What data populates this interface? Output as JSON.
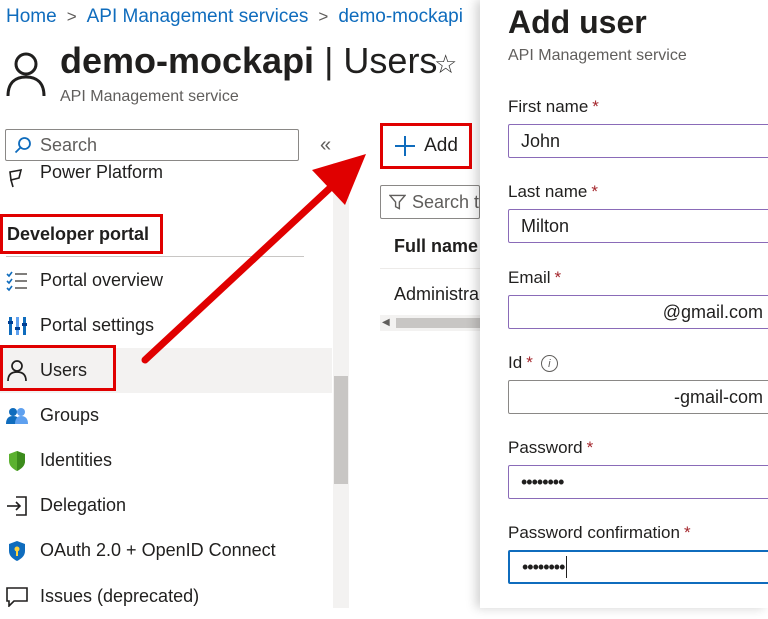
{
  "breadcrumb": {
    "items": [
      "Home",
      "API Management services",
      "demo-mockapi"
    ]
  },
  "header": {
    "title_bold": "demo-mockapi",
    "title_sep": " | ",
    "title_rest": "Users",
    "subtitle": "API Management service"
  },
  "sidebar": {
    "search_placeholder": "Search",
    "collapse_glyph": "«",
    "partial_item": "Power Platform",
    "section_title": "Developer portal",
    "items": [
      {
        "label": "Portal overview",
        "icon": "list-check-icon"
      },
      {
        "label": "Portal settings",
        "icon": "sliders-icon"
      },
      {
        "label": "Users",
        "icon": "user-icon",
        "selected": true
      },
      {
        "label": "Groups",
        "icon": "group-icon"
      },
      {
        "label": "Identities",
        "icon": "shield-icon"
      },
      {
        "label": "Delegation",
        "icon": "sign-in-icon"
      },
      {
        "label": "OAuth 2.0 + OpenID Connect",
        "icon": "shield-key-icon"
      },
      {
        "label": "Issues (deprecated)",
        "icon": "comment-icon"
      }
    ]
  },
  "toolbar": {
    "add_label": "Add"
  },
  "list": {
    "filter_placeholder": "Search t",
    "column_full_name": "Full name",
    "rows": [
      "Administra"
    ]
  },
  "panel": {
    "title": "Add user",
    "subtitle": "API Management service",
    "required_mark": "*",
    "fields": {
      "first_name": {
        "label": "First name",
        "value": "John"
      },
      "last_name": {
        "label": "Last name",
        "value": "Milton"
      },
      "email": {
        "label": "Email",
        "value": "@gmail.com"
      },
      "id": {
        "label": "Id",
        "value": "-gmail-com",
        "info": "i"
      },
      "password": {
        "label": "Password",
        "value": "••••••••"
      },
      "password_confirmation": {
        "label": "Password confirmation",
        "value": "••••••••"
      }
    }
  },
  "colors": {
    "accent": "#0f6cbd",
    "highlight": "#e00000",
    "required": "#a4262c",
    "input_border": "#8a6bb8"
  }
}
